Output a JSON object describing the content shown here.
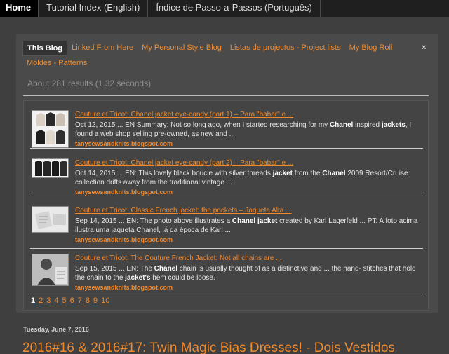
{
  "nav": {
    "tabs": [
      {
        "label": "Home"
      },
      {
        "label": "Tutorial Index (English)"
      },
      {
        "label": "Índice de Passo-a-Passos (Português)"
      }
    ]
  },
  "search": {
    "tabs": [
      {
        "label": "This Blog"
      },
      {
        "label": "Linked From Here"
      },
      {
        "label": "My Personal Style Blog"
      },
      {
        "label": "Listas de projectos - Project lists"
      },
      {
        "label": "My Blog Roll"
      },
      {
        "label": "Moldes - Patterns"
      }
    ],
    "close_label": "×",
    "result_count": "About 281 results (1.32 seconds)",
    "results": [
      {
        "title": "Couture et Tricot: Chanel jacket eye-candy (part 1) – Para \"babar\" e ...",
        "snippet": "Oct 12, 2015 ... EN Summary: Not so long ago, when I started researching for my Chanel inspired jackets, I found a web shop selling pre-owned, as new and ...",
        "url": "tanysewsandknits.blogspot.com"
      },
      {
        "title": "Couture et Tricot: Chanel jacket eye-candy (part 2) – Para \"babar\" e ...",
        "snippet": "Oct 14, 2015 ... EN: This lovely black boucle with silver threads jacket from the Chanel 2009 Resort/Cruise collection drifts away from the traditional vintage ...",
        "url": "tanysewsandknits.blogspot.com"
      },
      {
        "title": "Couture et Tricot: Classic French jacket: the pockets – Jaqueta Alta ...",
        "snippet": "Sep 14, 2015 ... EN: The photo above illustrates a Chanel jacket created by Karl Lagerfeld ... PT: A foto acima ilustra uma jaqueta Chanel, já da época de Karl ...",
        "url": "tanysewsandknits.blogspot.com"
      },
      {
        "title": "Couture et Tricot: The Couture French Jacket: Not all chains are ...",
        "snippet": "Sep 15, 2015 ... EN: The Chanel chain is usually thought of as a distinctive and ... the hand- stitches that hold the chain to the jacket's hem could be loose.",
        "url": "tanysewsandknits.blogspot.com"
      }
    ],
    "pages": [
      "1",
      "2",
      "3",
      "4",
      "5",
      "6",
      "7",
      "8",
      "9",
      "10"
    ]
  },
  "post": {
    "date": "Tuesday, June 7, 2016",
    "title": "2016#16 & 2016#17: Twin Magic Bias Dresses! - Dois Vestidos"
  }
}
